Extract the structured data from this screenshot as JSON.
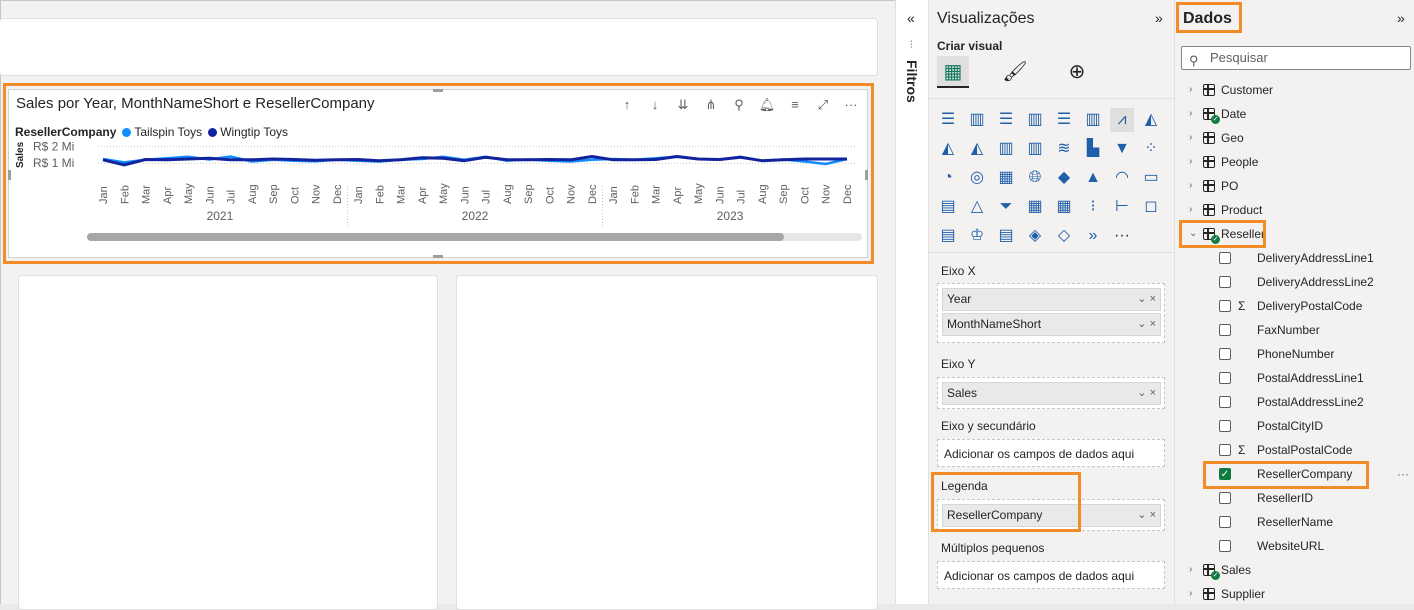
{
  "chart": {
    "title": "Sales por Year, MonthNameShort e ResellerCompany",
    "legend_title": "ResellerCompany",
    "y_axis_label": "Sales",
    "toolbar_icons": [
      "arrow-up-icon",
      "arrow-down-icon",
      "double-arrow-down-icon",
      "expand-hierarchy-icon",
      "pin-icon",
      "bell-icon",
      "filter-icon",
      "focus-mode-icon",
      "more-options-icon"
    ]
  },
  "chart_data": {
    "type": "line",
    "title": "Sales por Year, MonthNameShort e ResellerCompany",
    "ylabel": "Sales",
    "xlabel": "",
    "y_ticks": [
      "R$ 2 Mi",
      "R$ 1 Mi"
    ],
    "x": [
      "Jan",
      "Feb",
      "Mar",
      "Apr",
      "May",
      "Jun",
      "Jul",
      "Aug",
      "Sep",
      "Oct",
      "Nov",
      "Dec",
      "Jan",
      "Feb",
      "Mar",
      "Apr",
      "May",
      "Jun",
      "Jul",
      "Aug",
      "Sep",
      "Oct",
      "Nov",
      "Dec",
      "Jan",
      "Feb",
      "Mar",
      "Apr",
      "May",
      "Jun",
      "Jul",
      "Aug",
      "Sep",
      "Oct",
      "Nov",
      "Dec"
    ],
    "year_groups": [
      {
        "label": "2021",
        "months": 12
      },
      {
        "label": "2022",
        "months": 12
      },
      {
        "label": "2023",
        "months": 12
      }
    ],
    "ylim": [
      0,
      2.5
    ],
    "series": [
      {
        "name": "Tailspin Toys",
        "color": "#118dff",
        "values": [
          1.25,
          1.05,
          1.2,
          1.3,
          1.38,
          1.22,
          1.4,
          1.1,
          1.2,
          1.15,
          1.12,
          1.2,
          1.15,
          1.1,
          1.2,
          1.25,
          1.38,
          1.2,
          1.38,
          1.15,
          1.22,
          1.15,
          1.1,
          1.2,
          1.25,
          1.2,
          1.3,
          1.38,
          1.25,
          1.2,
          1.38,
          1.15,
          1.22,
          1.1,
          0.95,
          1.25
        ]
      },
      {
        "name": "Wingtip Toys",
        "color": "#12239e",
        "values": [
          1.2,
          0.9,
          1.22,
          1.2,
          1.25,
          1.3,
          1.2,
          1.2,
          1.25,
          1.22,
          1.18,
          1.2,
          1.22,
          1.15,
          1.2,
          1.32,
          1.3,
          1.15,
          1.35,
          1.2,
          1.2,
          1.22,
          1.2,
          1.4,
          1.2,
          1.2,
          1.22,
          1.4,
          1.25,
          1.22,
          1.35,
          1.15,
          1.2,
          1.25,
          1.25,
          1.25
        ]
      }
    ],
    "grid": true,
    "legend_position": "top-left"
  },
  "filters": {
    "label": "Filtros"
  },
  "visualizations": {
    "title": "Visualizações",
    "create_visual": "Criar visual",
    "x_axis": {
      "label": "Eixo X",
      "fields": [
        "Year",
        "MonthNameShort"
      ]
    },
    "y_axis": {
      "label": "Eixo Y",
      "fields": [
        "Sales"
      ]
    },
    "secondary_y": {
      "label": "Eixo y secundário",
      "placeholder": "Adicionar os campos de dados aqui"
    },
    "legend": {
      "label": "Legenda",
      "fields": [
        "ResellerCompany"
      ]
    },
    "small_multiples": {
      "label": "Múltiplos pequenos",
      "placeholder": "Adicionar os campos de dados aqui"
    },
    "more_visuals": "···"
  },
  "data": {
    "title": "Dados",
    "search_placeholder": "Pesquisar",
    "tables": [
      {
        "name": "Customer",
        "badge": false
      },
      {
        "name": "Date",
        "badge": true
      },
      {
        "name": "Geo",
        "badge": false
      },
      {
        "name": "People",
        "badge": false
      },
      {
        "name": "PO",
        "badge": false
      },
      {
        "name": "Product",
        "badge": false
      },
      {
        "name": "Reseller",
        "badge": true
      }
    ],
    "reseller_fields": [
      {
        "name": "DeliveryAddressLine1",
        "sigma": false,
        "checked": false
      },
      {
        "name": "DeliveryAddressLine2",
        "sigma": false,
        "checked": false
      },
      {
        "name": "DeliveryPostalCode",
        "sigma": true,
        "checked": false
      },
      {
        "name": "FaxNumber",
        "sigma": false,
        "checked": false
      },
      {
        "name": "PhoneNumber",
        "sigma": false,
        "checked": false
      },
      {
        "name": "PostalAddressLine1",
        "sigma": false,
        "checked": false
      },
      {
        "name": "PostalAddressLine2",
        "sigma": false,
        "checked": false
      },
      {
        "name": "PostalCityID",
        "sigma": false,
        "checked": false
      },
      {
        "name": "PostalPostalCode",
        "sigma": true,
        "checked": false
      },
      {
        "name": "ResellerCompany",
        "sigma": false,
        "checked": true
      },
      {
        "name": "ResellerID",
        "sigma": false,
        "checked": false
      },
      {
        "name": "ResellerName",
        "sigma": false,
        "checked": false
      },
      {
        "name": "WebsiteURL",
        "sigma": false,
        "checked": false
      }
    ],
    "tables_after": [
      {
        "name": "Sales",
        "badge": true
      },
      {
        "name": "Supplier",
        "badge": false
      }
    ]
  }
}
